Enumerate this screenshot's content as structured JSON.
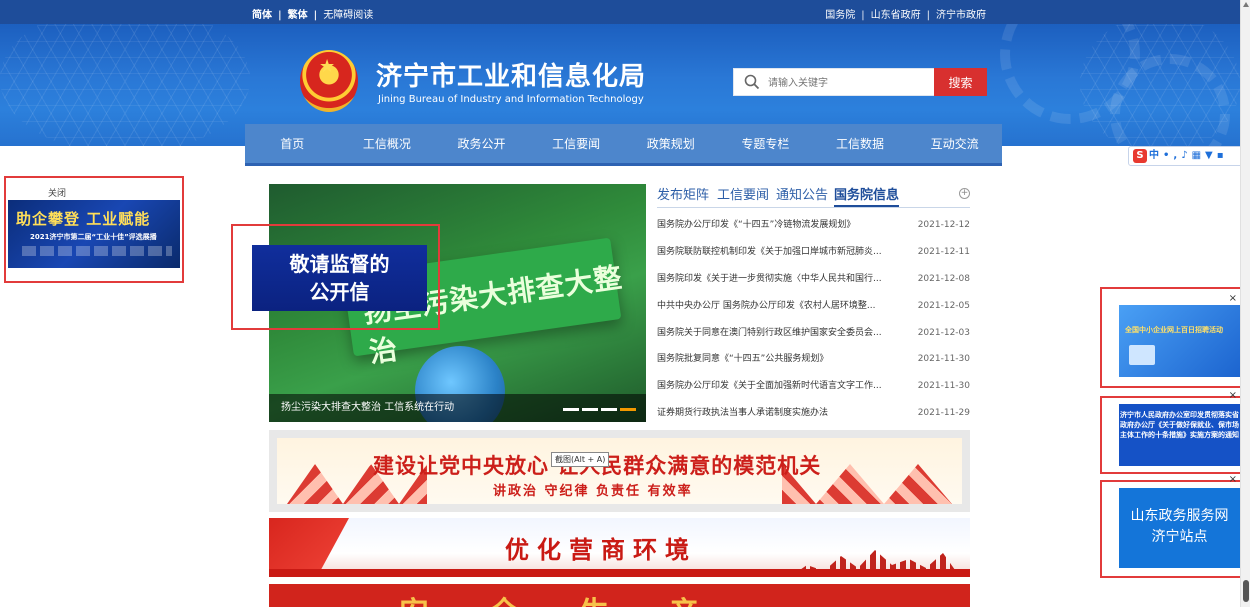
{
  "topbar": {
    "lang": [
      "简体",
      "繁体",
      "无障碍阅读"
    ],
    "links": [
      "国务院",
      "山东省政府",
      "济宁市政府"
    ]
  },
  "header": {
    "title": "济宁市工业和信息化局",
    "subtitle": "Jining Bureau of Industry and Information Technology",
    "search_placeholder": "请输入关键字",
    "search_button": "搜索"
  },
  "nav": [
    "首页",
    "工信概况",
    "政务公开",
    "工信要闻",
    "政策规划",
    "专题专栏",
    "工信数据",
    "互动交流"
  ],
  "left_float": {
    "close": "关闭",
    "banner_line1": "助企攀登 工业赋能",
    "banner_line2": "2021济宁市第二届“工业十佳”评选展播"
  },
  "slide": {
    "board_text": "扬尘污染大排查大整治",
    "caption": "扬尘污染大排查大整治 工信系统在行动",
    "dots": 4,
    "active_dot": 3
  },
  "overlay_letter": {
    "line1": "敬请监督的",
    "line2": "公开信"
  },
  "news": {
    "tabs": [
      "发布矩阵",
      "工信要闻",
      "通知公告",
      "国务院信息"
    ],
    "active_tab": 3,
    "more": "+",
    "items": [
      {
        "title": "国务院办公厅印发《“十四五”冷链物流发展规划》",
        "date": "2021-12-12"
      },
      {
        "title": "国务院联防联控机制印发《关于加强口岸城市新冠肺炎...",
        "date": "2021-12-11"
      },
      {
        "title": "国务院印发《关于进一步贯彻实施〈中华人民共和国行...",
        "date": "2021-12-08"
      },
      {
        "title": "中共中央办公厅 国务院办公厅印发《农村人居环境整...",
        "date": "2021-12-05"
      },
      {
        "title": "国务院关于同意在澳门特别行政区维护国家安全委员会...",
        "date": "2021-12-03"
      },
      {
        "title": "国务院批复同意《“十四五”公共服务规划》",
        "date": "2021-11-30"
      },
      {
        "title": "国务院办公厅印发《关于全面加强新时代语言文字工作...",
        "date": "2021-11-30"
      },
      {
        "title": "证券期货行政执法当事人承诺制度实施办法",
        "date": "2021-11-29"
      }
    ]
  },
  "banners": {
    "b1_line1": "建设让党中央放心 让人民群众满意的模范机关",
    "b1_line2": "讲政治 守纪律 负责任 有效率",
    "b1_tooltip": "截图(Alt + A)",
    "b2": "优化营商环境",
    "b3": "安全生产"
  },
  "right_floats": {
    "close": "×",
    "f1_text": "全国中小企业网上百日招聘活动",
    "f2_text": "济宁市人民政府办公室印发贯彻落实省政府办公厅《关于做好保就业、保市场主体工作的十条措施》实施方案的通知",
    "f3_line1": "山东政务服务网",
    "f3_line2": "济宁站点"
  },
  "ime": {
    "logo": "S",
    "label": "中",
    "icons": [
      "punctuation-icon",
      "mic-icon",
      "keyboard-icon",
      "skin-icon",
      "toolbox-icon"
    ]
  },
  "colors": {
    "topbar": "#1e4d9a",
    "nav": "#4d86cc",
    "search_button": "#d8302f",
    "annotation_box": "#e23b3b",
    "tab_active": "#1e4d9a"
  }
}
